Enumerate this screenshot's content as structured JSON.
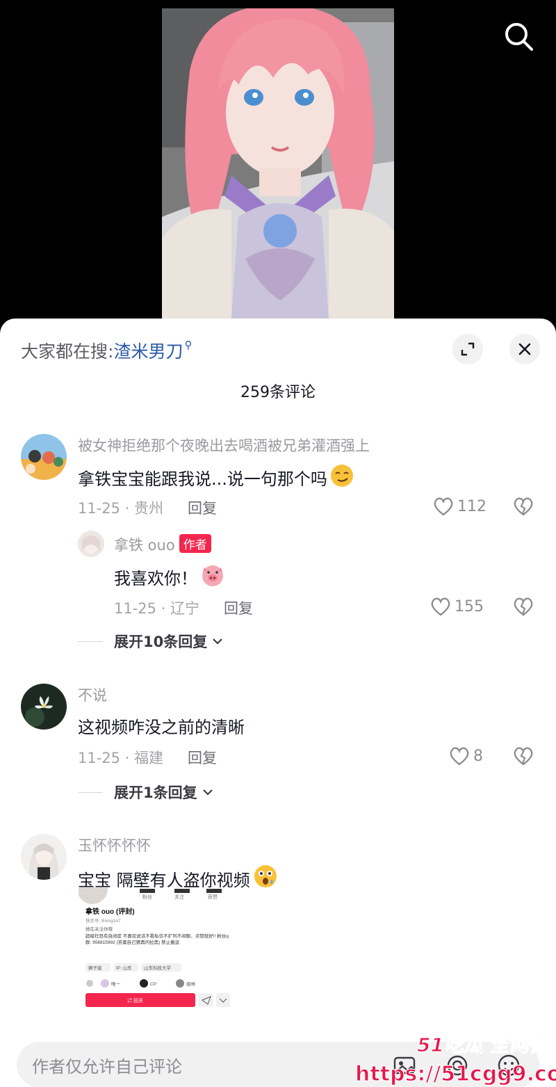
{
  "hot_search": {
    "prefix": "大家都在搜:",
    "term": "渣米男刀"
  },
  "comment_count": "259条评论",
  "comments": [
    {
      "user": "被女神拒绝那个夜晚出去喝酒被兄弟灌酒强上",
      "text": "拿铁宝宝能跟我说...说一句那个吗",
      "meta": "11-25 · 贵州",
      "reply": "回复",
      "likes": "112"
    },
    {
      "user": "不说",
      "text": "这视频咋没之前的清晰",
      "meta": "11-25 · 福建",
      "reply": "回复",
      "likes": "8",
      "expand": "展开1条回复"
    },
    {
      "user": "玉怀怀怀怀",
      "text": "宝宝 隔壁有人盗你视频"
    }
  ],
  "author_reply": {
    "user": "拿铁 ouo",
    "badge": "作者",
    "text": "我喜欢你！",
    "meta": "11-25 · 辽宁",
    "reply": "回复",
    "likes": "155",
    "expand": "展开10条回复"
  },
  "attached_profile": {
    "stats": [
      "粉丝",
      "关注",
      "获赞"
    ],
    "name": "拿铁 ouo (评封)",
    "id": "快手号: Bning147",
    "follows": "她在关注你哦",
    "bio": "超级社恐有自闭症 不喜欢说话不看私信不扩列不闲聊，点赞就好!! 粉丝q群: 956815992 (答案自己猜再问拉黑) 禁止搬运",
    "tags": [
      "狮子座",
      "IP: 山东",
      "山东科技大学"
    ],
    "row": [
      "唯一",
      "CP",
      "组林"
    ],
    "follow_btn": "⇄ 回关"
  },
  "input_placeholder": "作者仅允许自己评论",
  "watermark": {
    "line1": "51吃瓜 全网首发",
    "line2": "https://51cgg9.com"
  },
  "colors": {
    "accent_link": "#2b5aa8",
    "badge": "#f5264d",
    "watermark": "#e6174c"
  }
}
